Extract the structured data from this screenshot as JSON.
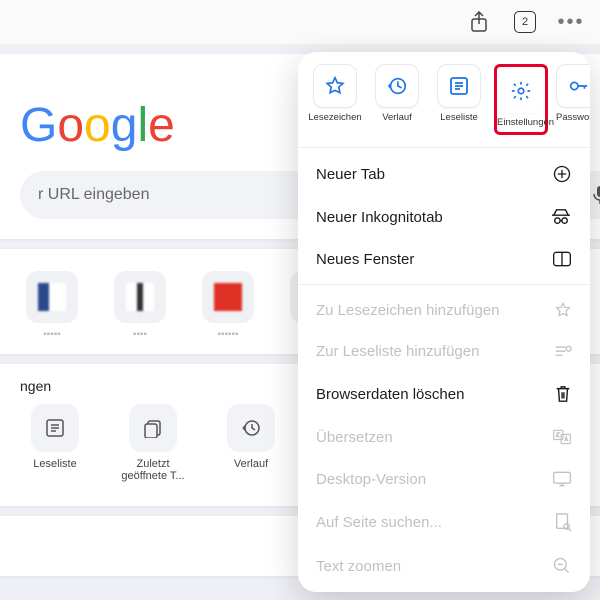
{
  "topbar": {
    "tab_count": "2"
  },
  "home": {
    "logo_letters": [
      "G",
      "o",
      "o",
      "g",
      "l",
      "e"
    ],
    "search_placeholder": "r URL eingeben",
    "row2_title": "ngen",
    "shortcuts": [
      {
        "label": "Leseliste"
      },
      {
        "label": "Zuletzt geöffnete T..."
      },
      {
        "label": "Verlauf"
      }
    ]
  },
  "popover": {
    "chips": [
      {
        "label": "Lesezeichen"
      },
      {
        "label": "Verlauf"
      },
      {
        "label": "Leseliste"
      },
      {
        "label": "Einstellungen",
        "highlight": true
      },
      {
        "label": "Passwortmanag"
      }
    ],
    "group1": [
      {
        "label": "Neuer Tab"
      },
      {
        "label": "Neuer Inkognitotab"
      },
      {
        "label": "Neues Fenster"
      }
    ],
    "group2": [
      {
        "label": "Zu Lesezeichen hinzufügen",
        "disabled": true
      },
      {
        "label": "Zur Leseliste hinzufügen",
        "disabled": true
      },
      {
        "label": "Browserdaten löschen",
        "disabled": false
      },
      {
        "label": "Übersetzen",
        "disabled": true
      },
      {
        "label": "Desktop-Version",
        "disabled": true
      },
      {
        "label": "Auf Seite suchen...",
        "disabled": true
      },
      {
        "label": "Text zoomen",
        "disabled": true
      }
    ]
  }
}
